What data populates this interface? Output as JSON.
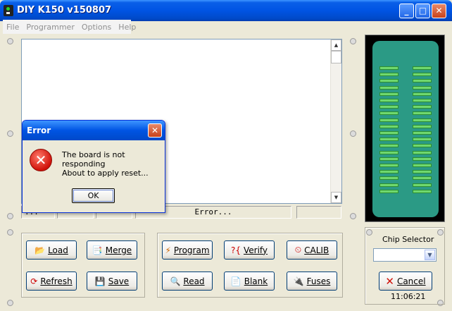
{
  "window": {
    "title": "DIY K150 v150807"
  },
  "menu": [
    "File",
    "Programmer",
    "Options",
    "Help"
  ],
  "status": {
    "left": "...",
    "message": "Error..."
  },
  "buttons": {
    "load": "Load",
    "merge": "Merge",
    "refresh": "Refresh",
    "save": "Save",
    "program": "Program",
    "verify": "Verify",
    "calib": "CALIB",
    "read": "Read",
    "blank": "Blank",
    "fuses": "Fuses",
    "cancel": "Cancel"
  },
  "chip_selector": {
    "label": "Chip Selector",
    "value": ""
  },
  "clock": "11:06:21",
  "dialog": {
    "title": "Error",
    "line1": "The board is not responding",
    "line2": "About to apply reset...",
    "ok": "OK"
  },
  "icons": {
    "load": "folder-open-icon",
    "merge": "merge-icon",
    "refresh": "refresh-icon",
    "save": "floppy-icon",
    "program": "program-icon",
    "verify": "verify-icon",
    "calib": "clock-icon",
    "read": "read-icon",
    "blank": "blank-page-icon",
    "fuses": "fuses-icon",
    "cancel": "cancel-x-icon",
    "error": "error-icon"
  },
  "colors": {
    "titlebar": "#0054e3",
    "socket": "#2b9a85",
    "pins": "#6fd86f",
    "error": "#d0120a",
    "cancel": "#d0120a"
  }
}
